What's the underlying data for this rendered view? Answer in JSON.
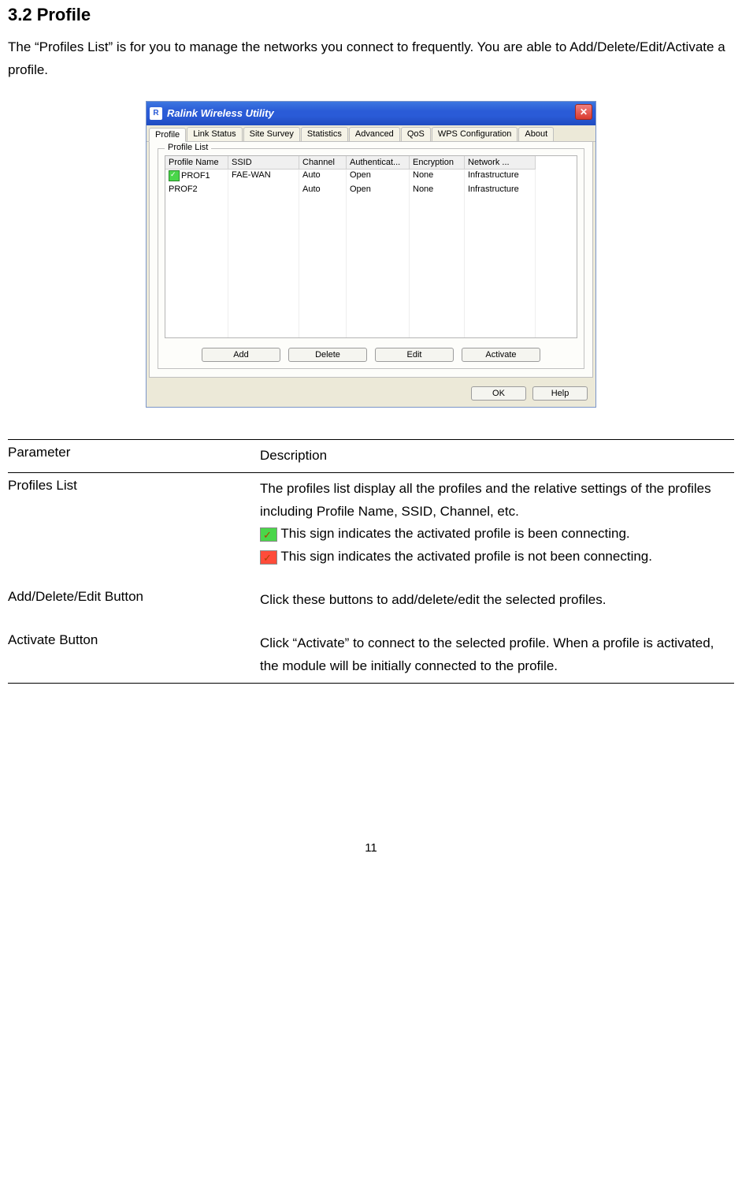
{
  "section_heading": "3.2    Profile",
  "intro": "The “Profiles List” is for you to manage the networks you connect to frequently. You are able to Add/Delete/Edit/Activate a profile.",
  "dialog": {
    "title": "Ralink Wireless Utility",
    "tabs": [
      "Profile",
      "Link Status",
      "Site Survey",
      "Statistics",
      "Advanced",
      "QoS",
      "WPS Configuration",
      "About"
    ],
    "active_tab": "Profile",
    "group_label": "Profile List",
    "columns": [
      "Profile Name",
      "SSID",
      "Channel",
      "Authenticat...",
      "Encryption",
      "Network ..."
    ],
    "rows": [
      {
        "active": true,
        "cells": [
          "PROF1",
          "FAE-WAN",
          "Auto",
          "Open",
          "None",
          "Infrastructure"
        ]
      },
      {
        "active": false,
        "cells": [
          "PROF2",
          "",
          "Auto",
          "Open",
          "None",
          "Infrastructure"
        ]
      }
    ],
    "buttons": [
      "Add",
      "Delete",
      "Edit",
      "Activate"
    ],
    "bottom_buttons": [
      "OK",
      "Help"
    ]
  },
  "param_table": {
    "head": [
      "Parameter",
      "Description"
    ],
    "rows": [
      {
        "param": "Profiles List",
        "desc_lines": [
          "The profiles list display all the profiles and the relative settings of the profiles including Profile Name, SSID, Channel, etc."
        ],
        "signs": [
          {
            "color": "green",
            "text": " This sign indicates the activated profile is been connecting."
          },
          {
            "color": "red",
            "text": " This sign indicates the activated profile is not been connecting."
          }
        ]
      },
      {
        "param": "Add/Delete/Edit Button",
        "desc_lines": [
          "Click these buttons to add/delete/edit the selected profiles."
        ]
      },
      {
        "param": "Activate Button",
        "desc_lines": [
          "Click “Activate” to connect to the selected profile. When a profile is activated, the module will be initially connected to the profile."
        ]
      }
    ]
  },
  "page_number": "11"
}
